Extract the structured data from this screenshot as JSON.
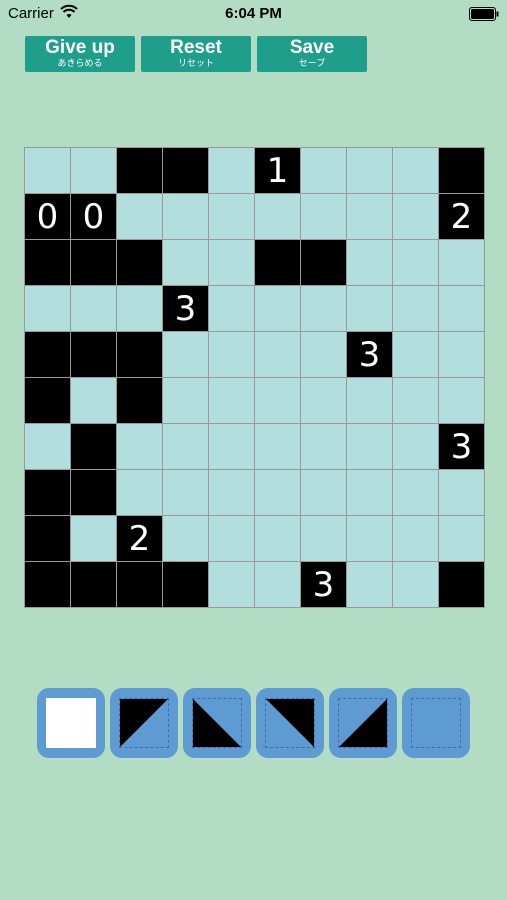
{
  "status": {
    "carrier": "Carrier",
    "time": "6:04 PM"
  },
  "buttons": [
    {
      "label": "Give up",
      "sub": "あきらめる"
    },
    {
      "label": "Reset",
      "sub": "リセット"
    },
    {
      "label": "Save",
      "sub": "セーブ"
    }
  ],
  "colors": {
    "background": "#b2dcc4",
    "button": "#1f9f8b",
    "cell_empty": "#b3dede",
    "cell_black": "#000000",
    "tool": "#5e9bd3"
  },
  "grid": {
    "rows": 10,
    "cols": 10,
    "cells": [
      [
        "",
        "",
        "B",
        "B",
        "",
        "1",
        "",
        "",
        "",
        "B"
      ],
      [
        "0",
        "0",
        "",
        "",
        "",
        "",
        "",
        "",
        "",
        "2"
      ],
      [
        "B",
        "B",
        "B",
        "",
        "",
        "B",
        "B",
        "",
        "",
        ""
      ],
      [
        "",
        "",
        "",
        "3",
        "",
        "",
        "",
        "",
        "",
        ""
      ],
      [
        "B",
        "B",
        "B",
        "",
        "",
        "",
        "",
        "3",
        "",
        ""
      ],
      [
        "B",
        "",
        "B",
        "",
        "",
        "",
        "",
        "",
        "",
        ""
      ],
      [
        "",
        "B",
        "",
        "",
        "",
        "",
        "",
        "",
        "",
        "3"
      ],
      [
        "B",
        "B",
        "",
        "",
        "",
        "",
        "",
        "",
        "",
        ""
      ],
      [
        "B",
        "",
        "2",
        "",
        "",
        "",
        "",
        "",
        "",
        ""
      ],
      [
        "B",
        "B",
        "B",
        "B",
        "",
        "",
        "3",
        "",
        "",
        "B"
      ]
    ]
  },
  "palette": [
    {
      "icon": "white-square-icon",
      "selected": true
    },
    {
      "icon": "triangle-top-left-icon",
      "selected": false
    },
    {
      "icon": "triangle-bottom-left-icon",
      "selected": false
    },
    {
      "icon": "triangle-top-right-icon",
      "selected": false
    },
    {
      "icon": "triangle-bottom-right-icon",
      "selected": false
    },
    {
      "icon": "empty-square-icon",
      "selected": false
    }
  ]
}
